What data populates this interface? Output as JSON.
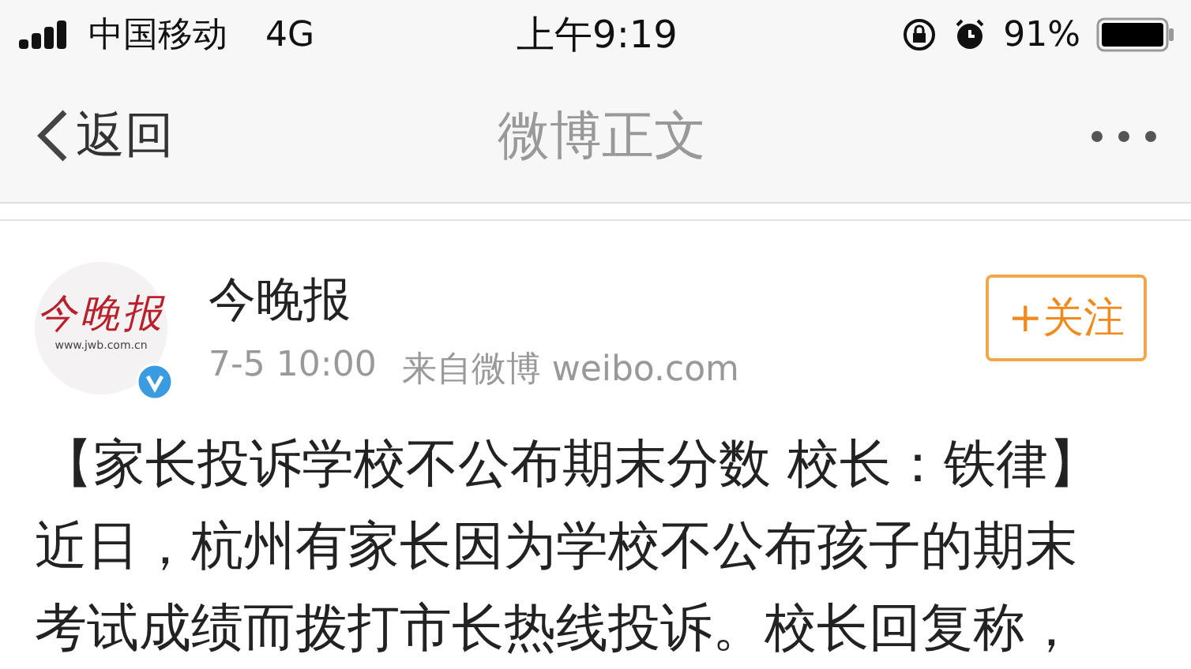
{
  "status_bar": {
    "carrier": "中国移动",
    "network": "4G",
    "time": "上午9:19",
    "battery": "91%"
  },
  "nav": {
    "back": "返回",
    "title": "微博正文"
  },
  "post": {
    "author": {
      "name": "今晚报",
      "logo_name": "今晚报",
      "logo_url": "www.jwb.com.cn",
      "verified": true
    },
    "time": "7-5 10:00",
    "source": "来自微博 weibo.com",
    "follow": "+关注",
    "headline": "【家长投诉学校不公布期末分数 校长：铁律】",
    "body": "近日，杭州有家长因为学校不公布孩子的期末考试成绩而拨打市长热线投诉。校长回复称，"
  }
}
